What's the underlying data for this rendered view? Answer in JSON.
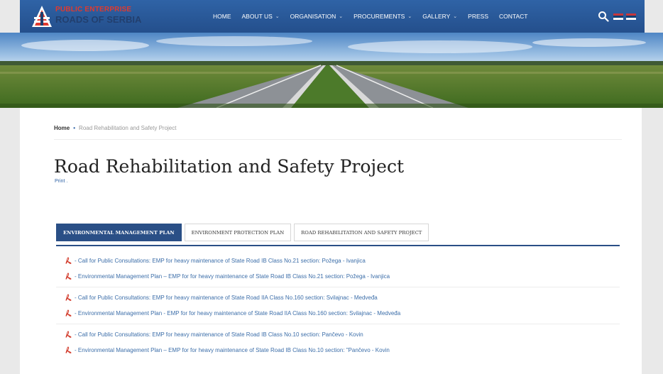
{
  "brand": {
    "line1": "PUBLIC ENTERPRISE",
    "line2": "ROADS OF SERBIA"
  },
  "nav": [
    {
      "label": "HOME",
      "dropdown": false
    },
    {
      "label": "ABOUT US",
      "dropdown": true
    },
    {
      "label": "ORGANISATION",
      "dropdown": true
    },
    {
      "label": "PROCUREMENTS",
      "dropdown": true
    },
    {
      "label": "GALLERY",
      "dropdown": true
    },
    {
      "label": "PRESS",
      "dropdown": false
    },
    {
      "label": "CONTACT",
      "dropdown": false
    }
  ],
  "breadcrumb": {
    "home": "Home",
    "separator": "•",
    "current": "Road Rehabilitation and Safety Project"
  },
  "page": {
    "title": "Road Rehabilitation and Safety Project",
    "print": "Print ."
  },
  "tabs": [
    {
      "label": "ENVIRONMENTAL MANAGEMENT PLAN",
      "active": true
    },
    {
      "label": "ENVIRONMENT PROTECTION PLAN",
      "active": false
    },
    {
      "label": "ROAD REHABILITATION AND SAFETY PROJECT",
      "active": false
    }
  ],
  "documents": [
    [
      "- Call for Public Consultations: EMP for heavy maintenance of State Road IB Class No.21 section: Požega - Ivanjica",
      "- Environmental Management Plan – EMP for for heavy maintenance of State Road IB Class No.21 section: Požega - Ivanjica"
    ],
    [
      "- Call for Public Consultations: EMP for heavy maintenance of State Road IIA Class No.160 section: Svilajnac - Medveđa",
      "- Environmental Management Plan - EMP for for heavy maintenance of State Road IIA Class No.160 section: Svilajnac - Medveđa"
    ],
    [
      "- Call for Public Consultations: EMP for heavy maintenance of State Road IB Class No.10 section: Pančevo - Kovin",
      "- Environmental Management Plan – EMP for for heavy maintenance of State Road IB Class No.10 section: \"Pančevo - Kovin"
    ]
  ],
  "icons": {
    "logo": "roads-of-serbia-logo",
    "search": "search-icon",
    "document": "pdf-icon",
    "chevron": "chevron-down-icon"
  },
  "colors": {
    "header": "#2f63a6",
    "tab_active": "#2a4f86",
    "link": "#3c6ea9",
    "brand_red": "#e03a2f"
  }
}
